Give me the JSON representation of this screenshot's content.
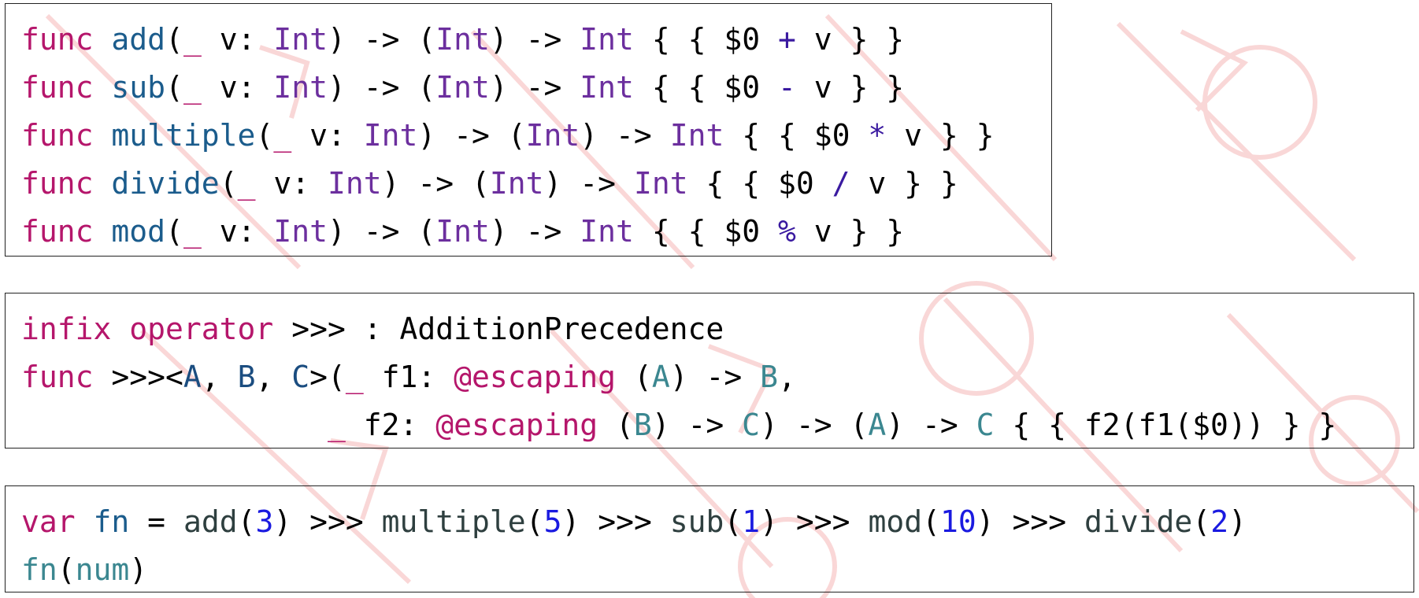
{
  "watermark": {
    "color": "#f5b7b7"
  },
  "colors": {
    "keyword": "#b5166b",
    "function": "#1b5c8c",
    "type": "#6c2f9e",
    "generic": "#3b8790",
    "number": "#1a1ae0"
  },
  "box1": {
    "lines": [
      [
        "func",
        " ",
        "add",
        "(",
        "_",
        " v: ",
        "Int",
        ") -> (",
        "Int",
        ") -> ",
        "Int",
        " { { $0 ",
        "+",
        " v } }"
      ],
      [
        "func",
        " ",
        "sub",
        "(",
        "_",
        " v: ",
        "Int",
        ") -> (",
        "Int",
        ") -> ",
        "Int",
        " { { $0 ",
        "-",
        " v } }"
      ],
      [
        "func",
        " ",
        "multiple",
        "(",
        "_",
        " v: ",
        "Int",
        ") -> (",
        "Int",
        ") -> ",
        "Int",
        " { { $0 ",
        "*",
        " v } }"
      ],
      [
        "func",
        " ",
        "divide",
        "(",
        "_",
        " v: ",
        "Int",
        ") -> (",
        "Int",
        ") -> ",
        "Int",
        " { { $0 ",
        "/",
        " v } }"
      ],
      [
        "func",
        " ",
        "mod",
        "(",
        "_",
        " v: ",
        "Int",
        ") -> (",
        "Int",
        ") -> ",
        "Int",
        " { { $0 ",
        "%",
        " v } }"
      ]
    ]
  },
  "box2": {
    "line1": {
      "kw1": "infix",
      "kw2": "operator",
      "rest": " >>> : AdditionPrecedence"
    },
    "line2": {
      "kw": "func",
      "op": " >>><",
      "a": "A",
      "c1": ", ",
      "b": "B",
      "c2": ", ",
      "c": "C",
      "open": ">(",
      "us": "_",
      "f1": " f1: ",
      "esc": "@escaping",
      "p1": " (",
      "ga": "A",
      "arr": ") -> ",
      "gb": "B",
      "end": ","
    },
    "line3": {
      "indent": "                 ",
      "us": "_",
      "f2": " f2: ",
      "esc": "@escaping",
      "p1": " (",
      "gb": "B",
      "arr1": ") -> ",
      "gc": "C",
      "arr2": ") -> (",
      "ga": "A",
      "arr3": ") -> ",
      "gc2": "C",
      "body": " { { f2(f1($0)) } }"
    }
  },
  "box3": {
    "line1": {
      "kw": "var",
      "name": "fn",
      "eq": " = ",
      "calls": [
        {
          "fn": "add",
          "arg": "3"
        },
        {
          "fn": "multiple",
          "arg": "5"
        },
        {
          "fn": "sub",
          "arg": "1"
        },
        {
          "fn": "mod",
          "arg": "10"
        },
        {
          "fn": "divide",
          "arg": "2"
        }
      ],
      "op": " >>> "
    },
    "line2": {
      "fn": "fn",
      "open": "(",
      "arg": "num",
      "close": ")"
    }
  }
}
